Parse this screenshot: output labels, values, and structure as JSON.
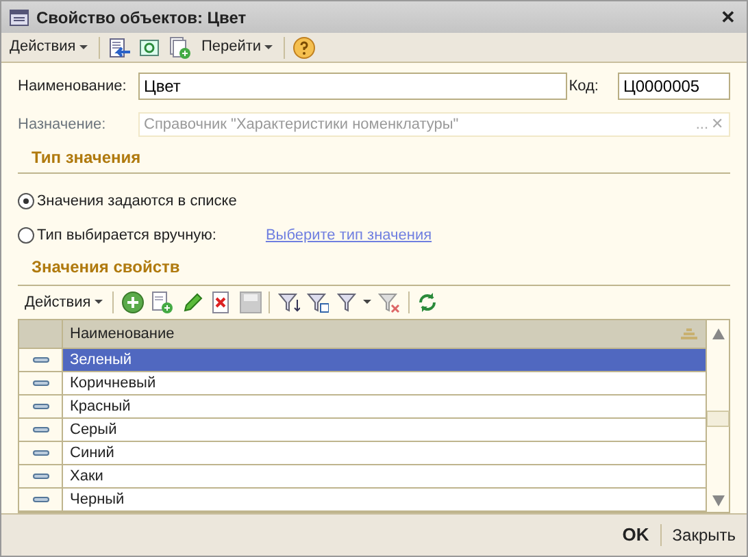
{
  "window": {
    "title": "Свойство объектов: Цвет",
    "close": "✕"
  },
  "toolbar": {
    "actions": "Действия",
    "goto": "Перейти"
  },
  "form": {
    "name_label": "Наименование:",
    "name_value": "Цвет",
    "code_label": "Код:",
    "code_value": "Ц0000005",
    "purpose_label": "Назначение:",
    "purpose_value": "Справочник \"Характеристики номенклатуры\"",
    "purpose_select": "...",
    "purpose_clear": "✕"
  },
  "value_type": {
    "heading": "Тип значения",
    "options": [
      {
        "label": "Значения задаются в списке",
        "selected": true
      },
      {
        "label": "Тип выбирается вручную:",
        "selected": false
      }
    ],
    "link": "Выберите тип значения"
  },
  "values": {
    "heading": "Значения свойств",
    "actions": "Действия",
    "columns": [
      "Наименование"
    ],
    "rows": [
      {
        "name": "Зеленый",
        "selected": true
      },
      {
        "name": "Коричневый",
        "selected": false
      },
      {
        "name": "Красный",
        "selected": false
      },
      {
        "name": "Серый",
        "selected": false
      },
      {
        "name": "Синий",
        "selected": false
      },
      {
        "name": "Хаки",
        "selected": false
      },
      {
        "name": "Черный",
        "selected": false
      }
    ]
  },
  "footer": {
    "ok": "OK",
    "close": "Закрыть"
  }
}
